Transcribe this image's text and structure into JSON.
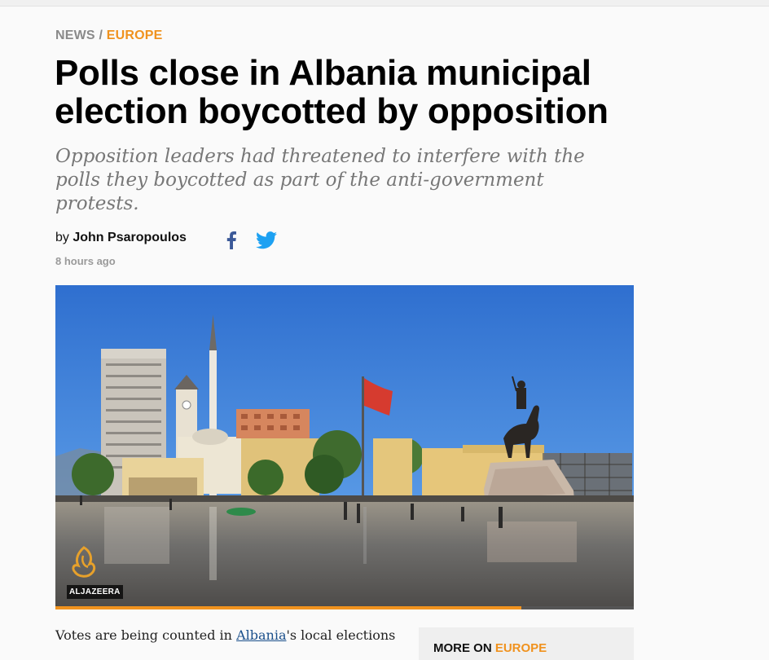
{
  "breadcrumb": {
    "section": "NEWS",
    "separator": "/",
    "category": "EUROPE"
  },
  "article": {
    "headline": "Polls close in Albania municipal election boycotted by opposition",
    "subheadline": "Opposition leaders had threatened to interfere with the polls they boycotted as part of the anti-government protests.",
    "byline_prefix": "by",
    "author": "John Psaropoulos",
    "timestamp": "8 hours ago",
    "body_start": "Votes are being counted in",
    "body_link": "Albania",
    "body_rest": "'s local elections"
  },
  "social": {
    "icons": [
      "facebook-icon",
      "twitter-icon"
    ]
  },
  "media": {
    "watermark": "ALJAZEERA",
    "progress_percent": 80.6
  },
  "sidebar": {
    "more_on_label": "MORE ON",
    "more_on_category": "EUROPE"
  },
  "colors": {
    "accent": "#f0921e",
    "facebook": "#3b5998",
    "twitter": "#1da1f2",
    "link": "#1a4f8b"
  }
}
